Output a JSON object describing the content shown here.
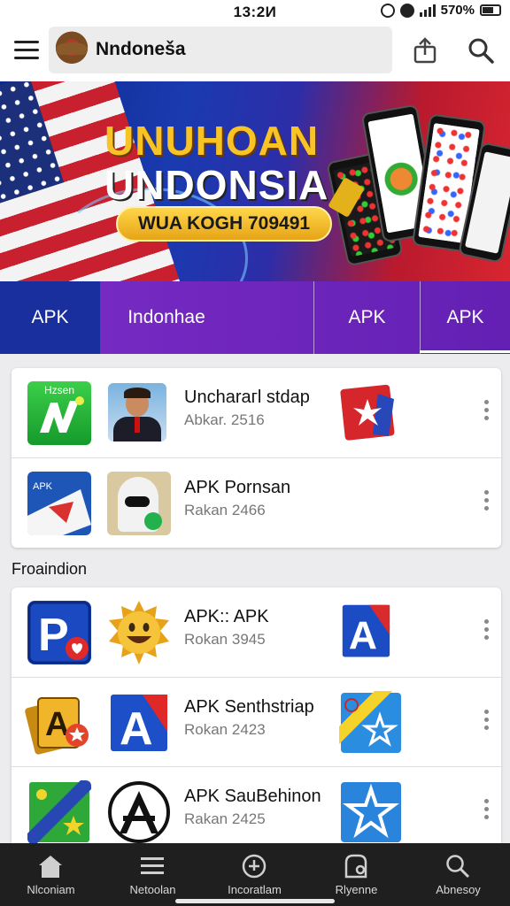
{
  "status_bar": {
    "time": "13:2И",
    "battery": "570%"
  },
  "app_bar": {
    "brand": "Nndoneša"
  },
  "banner": {
    "title_line1": "UNUHOAN",
    "title_line2": "UNDONSIA",
    "cta": "WUA KOGH 709491"
  },
  "tabs": [
    {
      "label": "APK",
      "active": true
    },
    {
      "label": "Indonhae",
      "active": false
    },
    {
      "label": "APK",
      "active": false
    },
    {
      "label": "APK",
      "active": false,
      "underlined": true
    }
  ],
  "featured": {
    "items": [
      {
        "badge": "Hzsen",
        "title": "Uncharaгl stdap",
        "subtitle": "Abkar. 2516"
      },
      {
        "title": "APK Pornsan",
        "subtitle": "Rakan 2466"
      }
    ]
  },
  "section": {
    "title": "Froaindion",
    "items": [
      {
        "title": "APK:: APK",
        "subtitle": "Rokan 3945"
      },
      {
        "title": "APK Senthstriap",
        "subtitle": "Rokan 2423"
      },
      {
        "title": "APK SauBehinon",
        "subtitle": "Rakan 2425"
      }
    ]
  },
  "bottom_nav": [
    {
      "label": "Nlconiam",
      "icon": "home-icon"
    },
    {
      "label": "Netoolan",
      "icon": "list-icon"
    },
    {
      "label": "Incoratlam",
      "icon": "download-icon"
    },
    {
      "label": "Rlyenne",
      "icon": "profile-icon"
    },
    {
      "label": "Abnesoy",
      "icon": "search-icon"
    }
  ],
  "colors": {
    "tab_bar": "#6a24b8",
    "tab_active": "#1a2f9e",
    "nav_bg": "#1f1f1f"
  }
}
